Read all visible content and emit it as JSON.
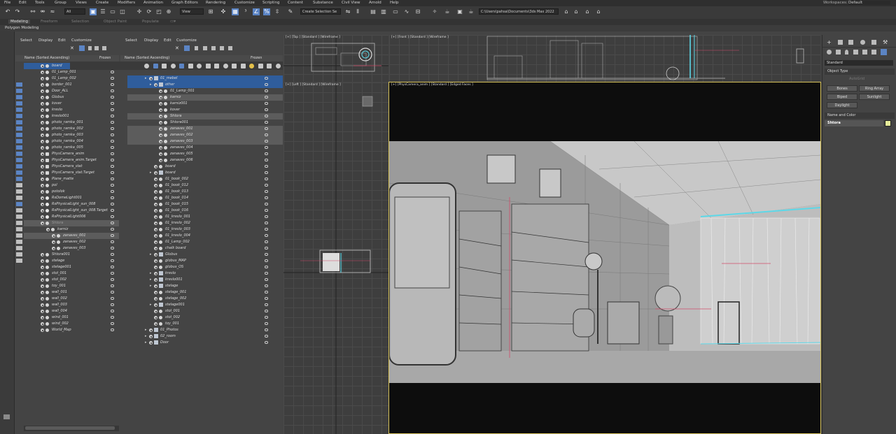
{
  "menus": [
    "File",
    "Edit",
    "Tools",
    "Group",
    "Views",
    "Create",
    "Modifiers",
    "Animation",
    "Graph Editors",
    "Rendering",
    "Customize",
    "Scripting",
    "Content",
    "Substance",
    "Civil View",
    "Arnold",
    "Help"
  ],
  "workspace": {
    "label": "Workspaces:",
    "value": "Default"
  },
  "toolbar": {
    "filter_dropdown": "All",
    "view_dropdown": "View",
    "selection_set": "Create Selection Se",
    "project_path": "C:\\Users\\pahsa\\Documents\\3ds Max 2022"
  },
  "ribbon": {
    "tabs": [
      "Modeling",
      "Freeform",
      "Selection",
      "Object Paint",
      "Populate"
    ],
    "active": "Modeling",
    "sub_label": "Polygon Modeling"
  },
  "explorer1": {
    "menu": [
      "Select",
      "Display",
      "Edit",
      "Customize"
    ],
    "header": "Name (Sorted Ascending)",
    "frozen": "Frozen",
    "rows": [
      {
        "name": "board",
        "depth": 0,
        "type": "obj",
        "sel": "sel2"
      },
      {
        "name": "01_Lamp_001",
        "depth": 0,
        "type": "obj"
      },
      {
        "name": "01_Lamp_002",
        "depth": 0,
        "type": "obj"
      },
      {
        "name": "border_001",
        "depth": 0,
        "type": "obj"
      },
      {
        "name": "Door_ALL",
        "depth": 0,
        "type": "obj"
      },
      {
        "name": "Globus",
        "depth": 0,
        "type": "obj"
      },
      {
        "name": "kover",
        "depth": 0,
        "type": "obj"
      },
      {
        "name": "kreslo",
        "depth": 0,
        "type": "obj"
      },
      {
        "name": "kreslo001",
        "depth": 0,
        "type": "obj"
      },
      {
        "name": "photo_ramka_001",
        "depth": 0,
        "type": "obj"
      },
      {
        "name": "photo_ramka_002",
        "depth": 0,
        "type": "obj"
      },
      {
        "name": "photo_ramka_003",
        "depth": 0,
        "type": "obj"
      },
      {
        "name": "photo_ramka_004",
        "depth": 0,
        "type": "obj"
      },
      {
        "name": "photo_ramka_005",
        "depth": 0,
        "type": "obj"
      },
      {
        "name": "PhysCamera_anim",
        "depth": 0,
        "type": "cam"
      },
      {
        "name": "PhysCamera_anim.Target",
        "depth": 0,
        "type": "cam"
      },
      {
        "name": "PhysCamera_stat",
        "depth": 0,
        "type": "cam"
      },
      {
        "name": "PhysCamera_stat.Target",
        "depth": 0,
        "type": "cam"
      },
      {
        "name": "Plane_matte",
        "depth": 0,
        "type": "obj"
      },
      {
        "name": "pol",
        "depth": 0,
        "type": "obj"
      },
      {
        "name": "potolok",
        "depth": 0,
        "type": "obj"
      },
      {
        "name": "RsDomeLight001",
        "depth": 0,
        "type": "light"
      },
      {
        "name": "RsPhysicalLight_sun_008",
        "depth": 0,
        "type": "light"
      },
      {
        "name": "RsPhysicalLight_sun_008.Target",
        "depth": 0,
        "type": "light"
      },
      {
        "name": "RsPhysicalLight006",
        "depth": 0,
        "type": "light"
      },
      {
        "name": "Shtora",
        "depth": 0,
        "type": "obj",
        "sel": "sel",
        "dim": true
      },
      {
        "name": "karniz",
        "depth": 1,
        "type": "obj"
      },
      {
        "name": "zanaves_001",
        "depth": 2,
        "type": "obj",
        "sel": "sel"
      },
      {
        "name": "zanaves_002",
        "depth": 2,
        "type": "obj"
      },
      {
        "name": "zanaves_003",
        "depth": 2,
        "type": "obj"
      },
      {
        "name": "Shtora001",
        "depth": 0,
        "type": "obj"
      },
      {
        "name": "stelage",
        "depth": 0,
        "type": "obj"
      },
      {
        "name": "stelage001",
        "depth": 0,
        "type": "obj"
      },
      {
        "name": "stol_001",
        "depth": 0,
        "type": "obj"
      },
      {
        "name": "stol_002",
        "depth": 0,
        "type": "obj"
      },
      {
        "name": "toy_001",
        "depth": 0,
        "type": "obj"
      },
      {
        "name": "wall_001",
        "depth": 0,
        "type": "obj"
      },
      {
        "name": "wall_002",
        "depth": 0,
        "type": "obj"
      },
      {
        "name": "wall_003",
        "depth": 0,
        "type": "obj"
      },
      {
        "name": "wall_004",
        "depth": 0,
        "type": "obj"
      },
      {
        "name": "wind_001",
        "depth": 0,
        "type": "obj"
      },
      {
        "name": "wind_002",
        "depth": 0,
        "type": "obj"
      },
      {
        "name": "World_Map",
        "depth": 0,
        "type": "obj"
      }
    ]
  },
  "explorer2": {
    "menu": [
      "Select",
      "Display",
      "Edit",
      "Customize"
    ],
    "header": "Name (Sorted Ascending)",
    "frozen": "Frozen",
    "rows": [
      {
        "name": "01_mebel",
        "depth": 1,
        "type": "layer",
        "sel": "sel2"
      },
      {
        "name": "other",
        "depth": 2,
        "type": "layer",
        "sel": "sel2"
      },
      {
        "name": "01_Lamp_001",
        "depth": 3,
        "type": "obj"
      },
      {
        "name": "karniz",
        "depth": 3,
        "type": "obj",
        "sel": "sel"
      },
      {
        "name": "karniz001",
        "depth": 3,
        "type": "obj"
      },
      {
        "name": "kover",
        "depth": 3,
        "type": "obj"
      },
      {
        "name": "Shtora",
        "depth": 3,
        "type": "obj",
        "sel": "sel"
      },
      {
        "name": "Shtora001",
        "depth": 3,
        "type": "obj"
      },
      {
        "name": "zanaves_001",
        "depth": 3,
        "type": "obj",
        "sel": "sel"
      },
      {
        "name": "zanaves_002",
        "depth": 3,
        "type": "obj",
        "sel": "sel"
      },
      {
        "name": "zanaves_003",
        "depth": 3,
        "type": "obj",
        "sel": "sel"
      },
      {
        "name": "zanaves_004",
        "depth": 3,
        "type": "obj"
      },
      {
        "name": "zanaves_005",
        "depth": 3,
        "type": "obj"
      },
      {
        "name": "zanaves_006",
        "depth": 3,
        "type": "obj"
      },
      {
        "name": "board",
        "depth": 2,
        "type": "obj"
      },
      {
        "name": "board",
        "depth": 2,
        "type": "layer"
      },
      {
        "name": "01_book_002",
        "depth": 2,
        "type": "obj"
      },
      {
        "name": "01_book_012",
        "depth": 2,
        "type": "obj"
      },
      {
        "name": "01_book_013",
        "depth": 2,
        "type": "obj"
      },
      {
        "name": "01_book_014",
        "depth": 2,
        "type": "obj"
      },
      {
        "name": "01_book_015",
        "depth": 2,
        "type": "obj"
      },
      {
        "name": "01_book_016",
        "depth": 2,
        "type": "obj"
      },
      {
        "name": "01_kreslo_001",
        "depth": 2,
        "type": "obj"
      },
      {
        "name": "01_kreslo_002",
        "depth": 2,
        "type": "obj"
      },
      {
        "name": "01_kreslo_003",
        "depth": 2,
        "type": "obj"
      },
      {
        "name": "01_kreslo_004",
        "depth": 2,
        "type": "obj"
      },
      {
        "name": "01_Lamp_002",
        "depth": 2,
        "type": "obj"
      },
      {
        "name": "chalk board",
        "depth": 2,
        "type": "obj"
      },
      {
        "name": "Globus",
        "depth": 2,
        "type": "layer"
      },
      {
        "name": "globus_MAP",
        "depth": 2,
        "type": "obj"
      },
      {
        "name": "globus_OS",
        "depth": 2,
        "type": "obj"
      },
      {
        "name": "kreslo",
        "depth": 2,
        "type": "layer"
      },
      {
        "name": "kreslo001",
        "depth": 2,
        "type": "layer"
      },
      {
        "name": "stelage",
        "depth": 2,
        "type": "layer"
      },
      {
        "name": "stelage_001",
        "depth": 2,
        "type": "obj"
      },
      {
        "name": "stelage_002",
        "depth": 2,
        "type": "obj"
      },
      {
        "name": "stelage001",
        "depth": 2,
        "type": "layer"
      },
      {
        "name": "stol_001",
        "depth": 2,
        "type": "obj"
      },
      {
        "name": "stol_002",
        "depth": 2,
        "type": "obj"
      },
      {
        "name": "toy_001",
        "depth": 2,
        "type": "obj"
      },
      {
        "name": "01_Photos",
        "depth": 1,
        "type": "layer"
      },
      {
        "name": "02_room",
        "depth": 1,
        "type": "layer"
      },
      {
        "name": "Door",
        "depth": 1,
        "type": "layer"
      }
    ]
  },
  "viewports": {
    "top": "[+] [Top ] [Standard ] [Wireframe ]",
    "front": "[+] [Front ] [Standard ] [Wireframe ]",
    "left": "[+] [Left ] [Standard ] [Wireframe ]",
    "camera": "[+] [PhysCamera_anim ] [Standard ] [Edged Faces ]"
  },
  "command_panel": {
    "dropdown": "Standard",
    "object_type_label": "Object Type",
    "autogrid": "AutoGrid",
    "buttons": [
      "Bones",
      "Ring Array",
      "Biped",
      "Sunlight",
      "Daylight"
    ],
    "name_color_label": "Name and Color",
    "name_value": "Shtora",
    "swatch_color": "#e6ec9a"
  },
  "colors": {
    "selection_blue": "#2f5d9c",
    "active_button": "#5b84c4",
    "viewport_border": "#d8c35a"
  }
}
